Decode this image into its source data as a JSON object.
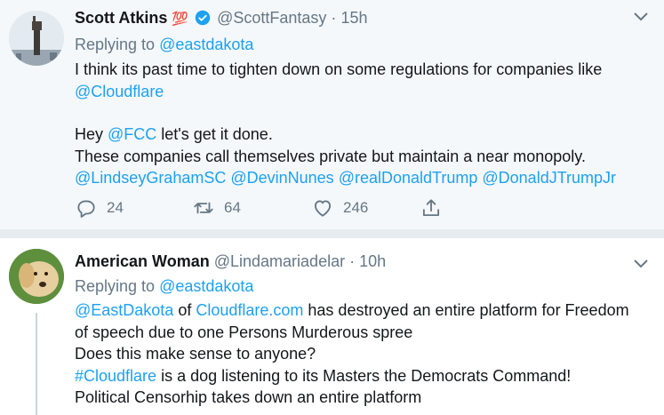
{
  "tweet1": {
    "name": "Scott Atkins",
    "badge": "💯",
    "handle": "@ScottFantasy",
    "dot": "·",
    "time": "15h",
    "reply_prefix": "Replying to",
    "reply_to": "@eastdakota",
    "line1": "I think its past time to tighten down on some regulations for companies like",
    "mention_cloudflare": "@Cloudflare",
    "hey": "Hey",
    "mention_fcc": "@FCC",
    "hey_rest": " let's get it done.",
    "line4": "These companies call themselves private but maintain a near monopoly.",
    "mentions": [
      "@LindseyGrahamSC",
      "@DevinNunes",
      "@realDonaldTrump",
      "@DonaldJTrumpJr"
    ],
    "replies": "24",
    "retweets": "64",
    "likes": "246"
  },
  "tweet2": {
    "name": "American Woman",
    "handle": "@Lindamariadelar",
    "dot": "·",
    "time": "10h",
    "reply_prefix": "Replying to",
    "reply_to": "@eastdakota",
    "mention_east": "@EastDakota",
    "of": " of ",
    "link_cf": "Cloudflare.com",
    "line1_rest": " has destroyed an entire platform for Freedom",
    "line2": "of speech due to one Persons Murderous spree",
    "line3": "Does this make sense to anyone?",
    "hashtag": "#Cloudflare",
    "line4_rest": " is a dog listening to its Masters the Democrats Command!",
    "line5": "Political Censorhip takes down an entire platform"
  },
  "colors": {
    "link": "#1da1f2",
    "muted": "#657786",
    "bg1": "#f5f8fa",
    "divider": "#e6ecf0"
  }
}
